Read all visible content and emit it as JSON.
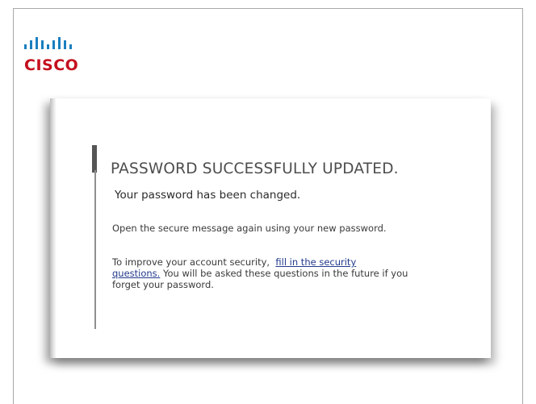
{
  "logo": {
    "icon_name": "cisco-bridge-bars-icon",
    "wordmark": "CISCO",
    "bar_color": "#1a7fbf",
    "wordmark_color": "#c5101f"
  },
  "message": {
    "heading": "PASSWORD SUCCESSFULLY UPDATED.",
    "subheading": "Your password has been changed.",
    "instruction": "Open the secure message again using your new password.",
    "security_prefix": "To improve your account security,",
    "security_link_part1": "fill in the security",
    "security_link_part2": "questions.",
    "security_suffix_1": "You will be asked these questions in the future if you",
    "security_suffix_2": "forget your password."
  },
  "colors": {
    "heading": "#4d4d4d",
    "link": "#223a8c",
    "accent_rule": "#555555"
  }
}
